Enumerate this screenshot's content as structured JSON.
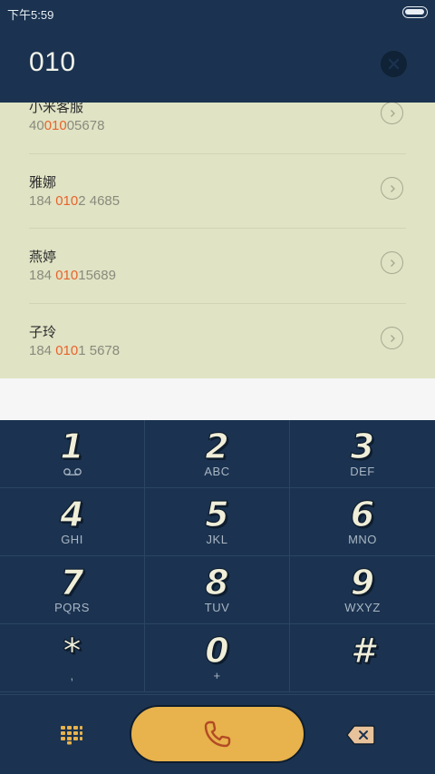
{
  "status_bar": {
    "time": "下午5:59"
  },
  "dialer": {
    "input_value": "010"
  },
  "results": [
    {
      "name": "小米客服",
      "number_before": "40",
      "number_match": "010",
      "number_after": "05678"
    },
    {
      "name": "雅娜",
      "number_before": "184 ",
      "number_match": "010",
      "number_after": "2 4685"
    },
    {
      "name": "燕婷",
      "number_before": "184 ",
      "number_match": "010",
      "number_after": "15689"
    },
    {
      "name": "子玲",
      "number_before": "184 ",
      "number_match": "010",
      "number_after": "1 5678"
    }
  ],
  "keypad": [
    {
      "digit": "1",
      "letters": ""
    },
    {
      "digit": "2",
      "letters": "ABC"
    },
    {
      "digit": "3",
      "letters": "DEF"
    },
    {
      "digit": "4",
      "letters": "GHI"
    },
    {
      "digit": "5",
      "letters": "JKL"
    },
    {
      "digit": "6",
      "letters": "MNO"
    },
    {
      "digit": "7",
      "letters": "PQRS"
    },
    {
      "digit": "8",
      "letters": "TUV"
    },
    {
      "digit": "9",
      "letters": "WXYZ"
    },
    {
      "digit": "*",
      "letters": ","
    },
    {
      "digit": "0",
      "letters": "+"
    },
    {
      "digit": "#",
      "letters": ""
    }
  ],
  "icons": {
    "clear": "close-icon",
    "detail": "chevron-right-icon",
    "voicemail": "voicemail-icon",
    "dialpad": "dialpad-grid-icon",
    "call": "phone-icon",
    "backspace": "backspace-icon"
  },
  "colors": {
    "header_bg": "#1b3350",
    "results_bg": "#e0e3c4",
    "match_highlight": "#e8632b",
    "call_button": "#e8b24c",
    "dialpad_icon": "#e8b24c",
    "backspace_icon": "#e8c29a"
  }
}
